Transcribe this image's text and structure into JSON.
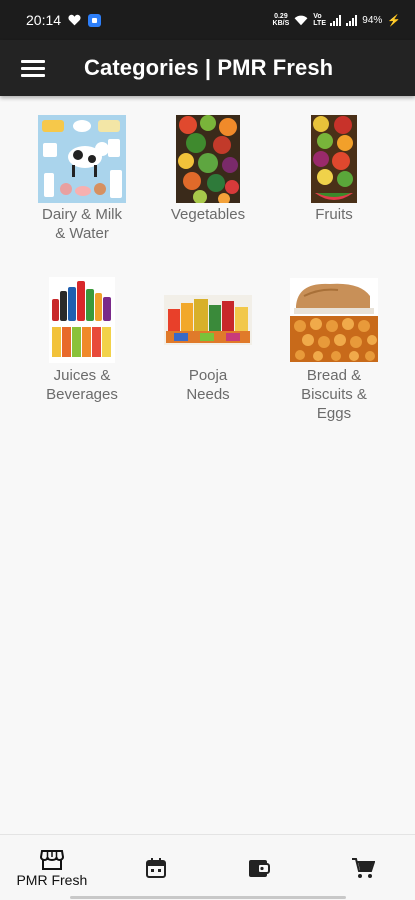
{
  "status_bar": {
    "time": "20:14",
    "speed_top": "0.29",
    "speed_bottom": "KB/S",
    "network_label": "Vo LTE",
    "battery": "94%"
  },
  "app_bar": {
    "title": "Categories | PMR Fresh",
    "menu_icon": "menu-icon"
  },
  "categories": [
    {
      "label_line1": "Dairy & Milk",
      "label_line2": "& Water",
      "label_line3": "",
      "image": "dairy-milk-water-image"
    },
    {
      "label_line1": "Vegetables",
      "label_line2": "",
      "label_line3": "",
      "image": "vegetables-image"
    },
    {
      "label_line1": "Fruits",
      "label_line2": "",
      "label_line3": "",
      "image": "fruits-image"
    },
    {
      "label_line1": "Juices &",
      "label_line2": "Beverages",
      "label_line3": "",
      "image": "juices-beverages-image"
    },
    {
      "label_line1": "Pooja",
      "label_line2": "Needs",
      "label_line3": "",
      "image": "pooja-needs-image"
    },
    {
      "label_line1": "Bread &",
      "label_line2": "Biscuits &",
      "label_line3": "Eggs",
      "image": "bread-biscuits-eggs-image"
    }
  ],
  "bottom_nav": {
    "items": [
      {
        "label": "PMR Fresh",
        "icon": "store-icon"
      },
      {
        "label": "",
        "icon": "calendar-icon"
      },
      {
        "label": "",
        "icon": "wallet-icon"
      },
      {
        "label": "",
        "icon": "cart-icon"
      }
    ]
  },
  "colors": {
    "status_bar": "#1c1c1c",
    "app_bar": "#232323",
    "background": "#f8f8f8",
    "label_text": "#6b6b6b"
  }
}
